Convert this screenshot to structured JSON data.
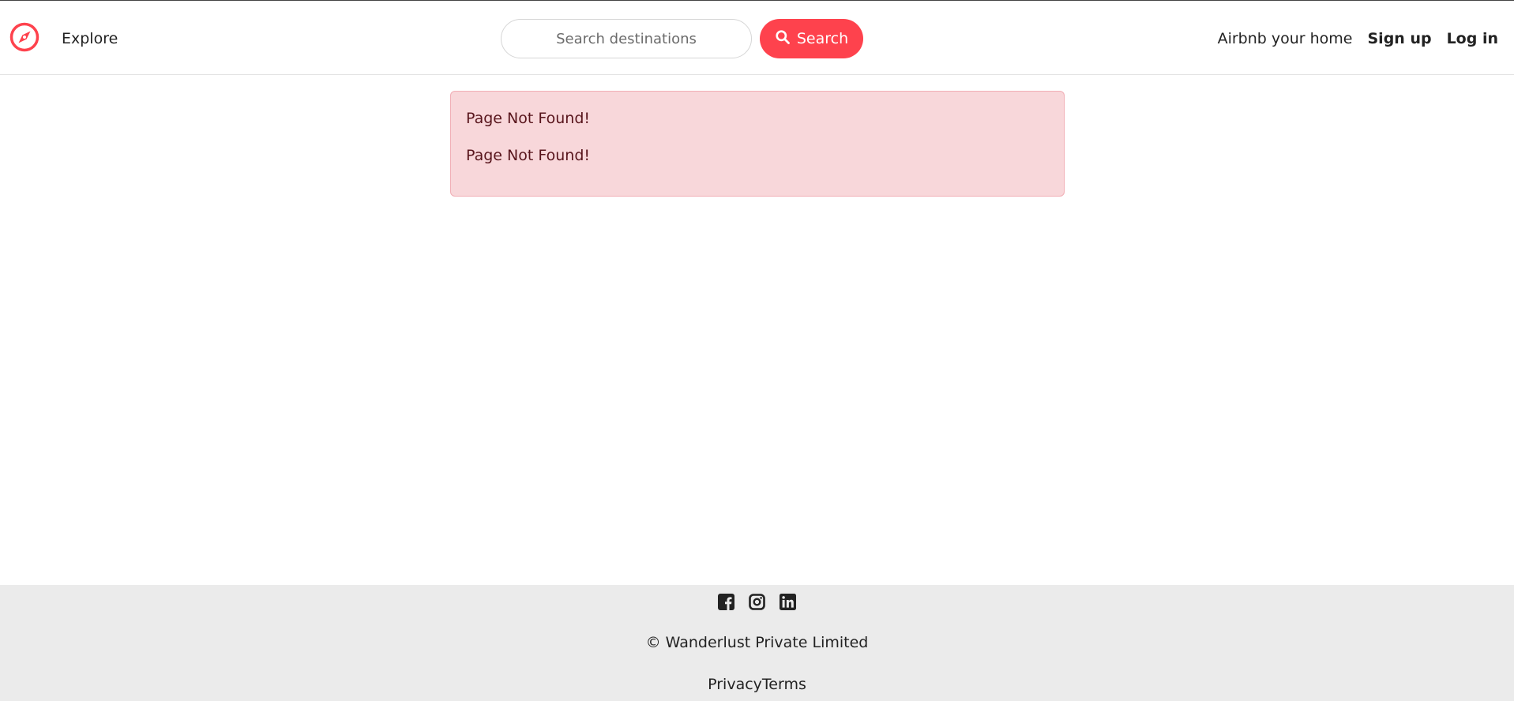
{
  "navbar": {
    "brand_icon": "compass-icon",
    "explore_label": "Explore",
    "search": {
      "placeholder": "Search destinations",
      "value": ""
    },
    "search_button_label": "Search",
    "search_button_icon": "search-icon",
    "right_links": [
      "Airbnb your home",
      "Sign up",
      "Log in"
    ]
  },
  "alert": {
    "messages": [
      "Page Not Found!",
      "Page Not Found!"
    ]
  },
  "footer": {
    "social_icons": [
      "facebook-icon",
      "instagram-icon",
      "linkedin-icon"
    ],
    "copyright": "© Wanderlust Private Limited",
    "links": [
      "Privacy",
      "Terms"
    ]
  },
  "colors": {
    "accent": "#fe424d",
    "alert_bg": "#f8d7da",
    "alert_border": "#f1aeb5",
    "alert_text": "#58151c",
    "footer_bg": "#ebebeb"
  }
}
